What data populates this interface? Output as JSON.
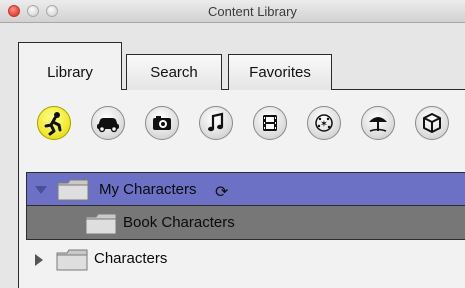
{
  "window": {
    "title": "Content Library"
  },
  "tabs": [
    {
      "label": "Library",
      "active": true
    },
    {
      "label": "Search",
      "active": false
    },
    {
      "label": "Favorites",
      "active": false
    }
  ],
  "categories": [
    {
      "icon": "runner-icon",
      "active": true
    },
    {
      "icon": "car-icon",
      "active": false
    },
    {
      "icon": "camera-icon",
      "active": false
    },
    {
      "icon": "music-note-icon",
      "active": false
    },
    {
      "icon": "film-icon",
      "active": false
    },
    {
      "icon": "sparkle-particles-icon",
      "active": false
    },
    {
      "icon": "beach-umbrella-icon",
      "active": false
    },
    {
      "icon": "cube-icon",
      "active": false
    }
  ],
  "tree": {
    "rows": [
      {
        "label": "My Characters",
        "expanded": true,
        "selected": true
      },
      {
        "label": "Book Characters"
      },
      {
        "label": "Characters",
        "expanded": false
      }
    ]
  },
  "colors": {
    "selected_row": "#6d71c6",
    "child_row": "#777777",
    "active_category": "#f1ea2f"
  }
}
